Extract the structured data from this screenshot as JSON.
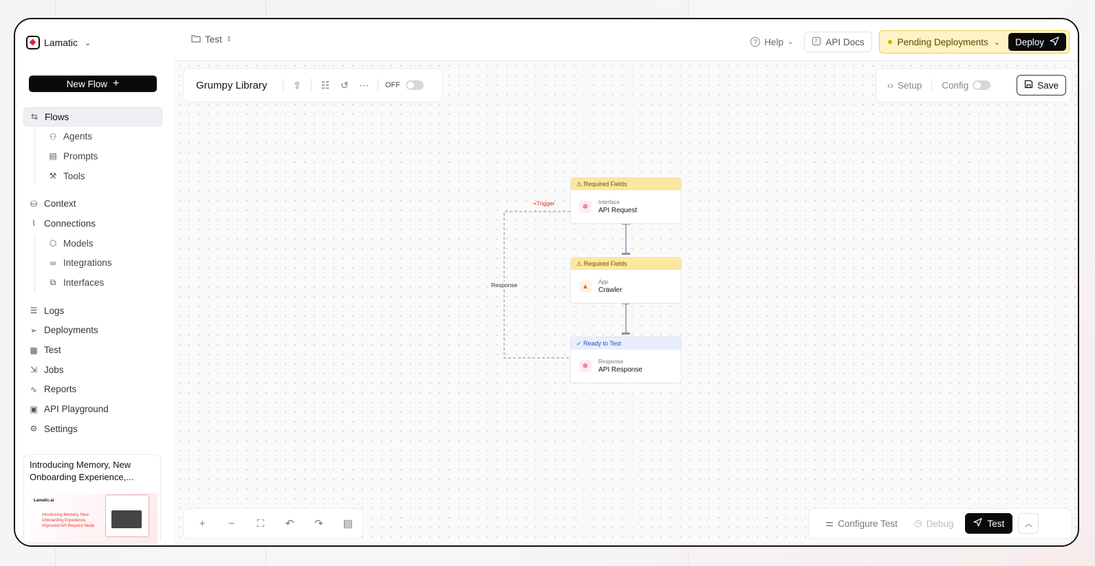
{
  "brand": {
    "name": "Lamatic",
    "chevron": "⌄"
  },
  "sidebar": {
    "new_flow": "New Flow",
    "items": [
      {
        "label": "Flows",
        "icon": "flows-icon",
        "glyph": "⇆"
      },
      {
        "label": "Agents",
        "icon": "bot-icon",
        "glyph": "⚇"
      },
      {
        "label": "Prompts",
        "icon": "document-icon",
        "glyph": "▤"
      },
      {
        "label": "Tools",
        "icon": "wrench-icon",
        "glyph": "⚒"
      },
      {
        "label": "Context",
        "icon": "database-icon",
        "glyph": "⛁"
      },
      {
        "label": "Connections",
        "icon": "connections-icon",
        "glyph": "⌇"
      },
      {
        "label": "Models",
        "icon": "cube-icon",
        "glyph": "⬡"
      },
      {
        "label": "Integrations",
        "icon": "link-icon",
        "glyph": "∞"
      },
      {
        "label": "Interfaces",
        "icon": "interface-icon",
        "glyph": "⧉"
      },
      {
        "label": "Logs",
        "icon": "list-icon",
        "glyph": "☰"
      },
      {
        "label": "Deployments",
        "icon": "send-icon",
        "glyph": "➢"
      },
      {
        "label": "Test",
        "icon": "table-icon",
        "glyph": "▦"
      },
      {
        "label": "Jobs",
        "icon": "jobs-icon",
        "glyph": "⇲"
      },
      {
        "label": "Reports",
        "icon": "activity-icon",
        "glyph": "∿"
      },
      {
        "label": "API Playground",
        "icon": "terminal-icon",
        "glyph": "▣"
      },
      {
        "label": "Settings",
        "icon": "gear-icon",
        "glyph": "⚙"
      }
    ],
    "promo": {
      "title": "Introducing Memory, New Onboarding Experience,...",
      "image_logo": "Lamatic.ai",
      "image_text": "Introducing Memory, New Onboarding Experience, Improved API Request Node"
    }
  },
  "topbar": {
    "breadcrumb": "Test",
    "help": "Help",
    "api_docs": "API Docs",
    "pending": "Pending Deployments",
    "deploy": "Deploy"
  },
  "flowbar": {
    "name": "Grumpy Library",
    "toggle_label": "OFF"
  },
  "rightbar": {
    "setup": "Setup",
    "config": "Config",
    "save": "Save"
  },
  "nodes": [
    {
      "badge": "⚠ Required Fields",
      "type": "Interface",
      "title": "API Request",
      "status": "required"
    },
    {
      "badge": "⚠ Required Fields",
      "type": "App",
      "title": "Crawler",
      "status": "required"
    },
    {
      "badge": "✓ Ready to Test",
      "type": "Response",
      "title": "API Response",
      "status": "ready"
    }
  ],
  "edges": {
    "trigger_label": "+Trigger",
    "response_label": "Response"
  },
  "testbar": {
    "configure": "Configure Test",
    "debug": "Debug",
    "test": "Test"
  },
  "colors": {
    "accent": "#0a0a0a",
    "warning_bg": "#fbe7a0",
    "pending_bg": "#fdf3c4",
    "ready_bg": "#e8eefc",
    "trigger": "#e02626"
  }
}
